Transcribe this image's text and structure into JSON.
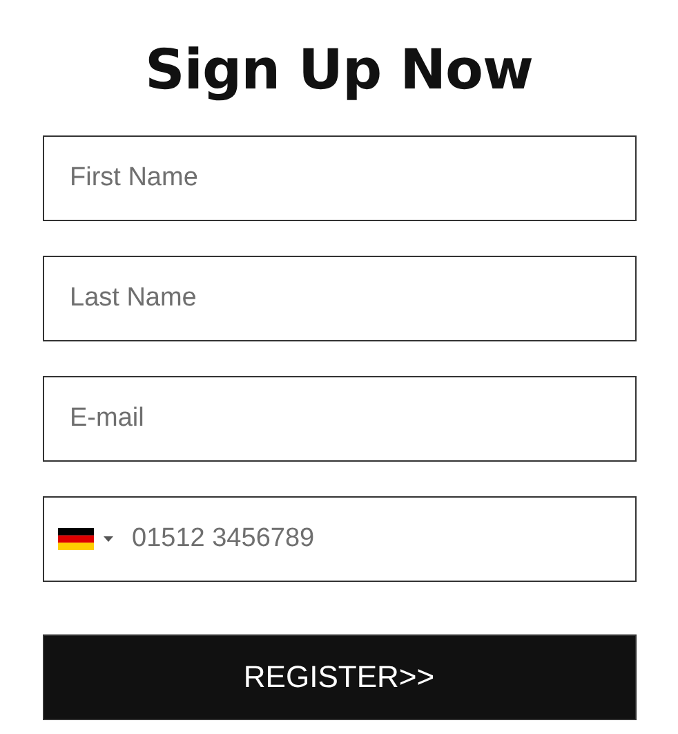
{
  "title": "Sign Up Now",
  "fields": [
    {
      "kind": "text",
      "placeholder": "First Name"
    },
    {
      "kind": "text",
      "placeholder": "Last Name"
    },
    {
      "kind": "text",
      "placeholder": "E-mail"
    },
    {
      "kind": "phone",
      "placeholder": "01512 3456789"
    }
  ],
  "submit": "REGISTER>>"
}
